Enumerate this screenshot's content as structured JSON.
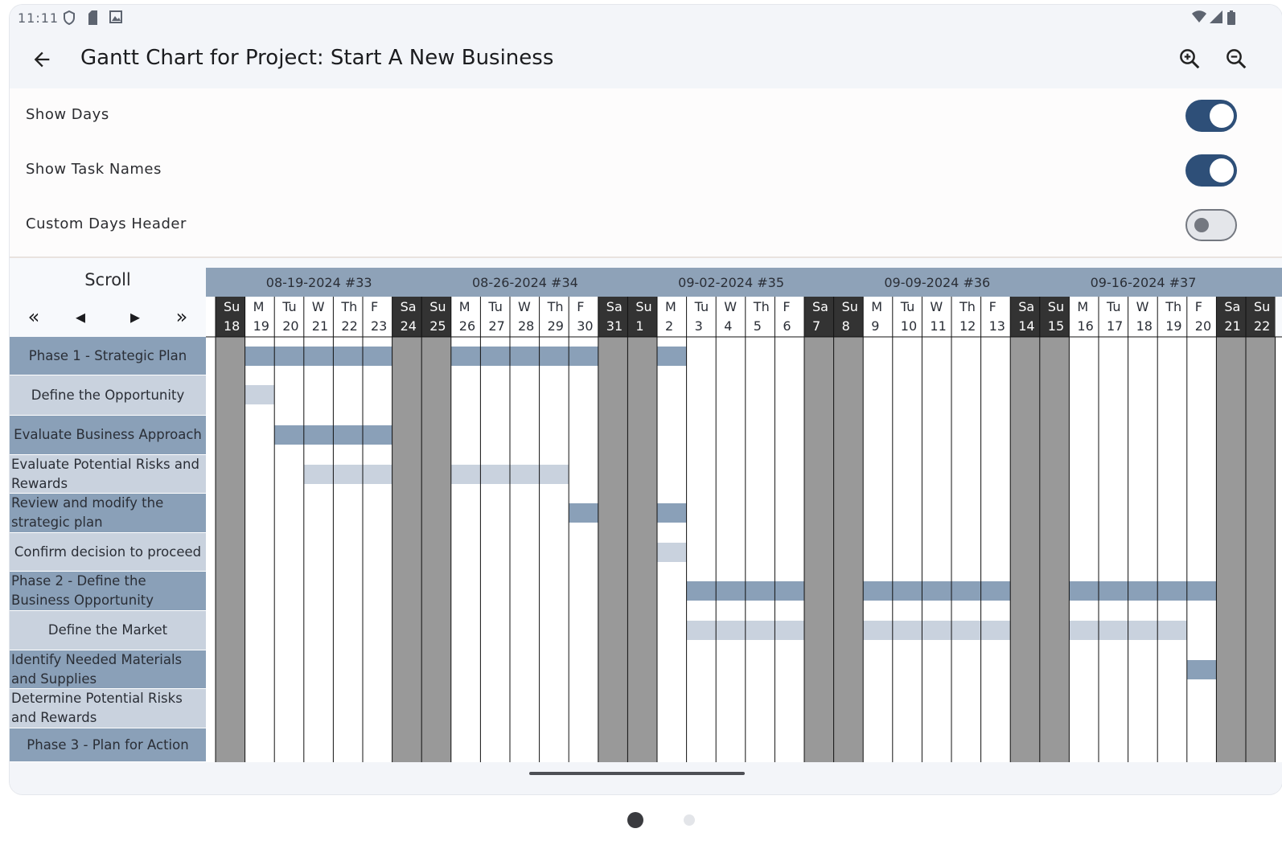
{
  "status_bar": {
    "time": "11:11"
  },
  "header": {
    "title": "Gantt Chart for Project:  Start A New Business"
  },
  "settings": [
    {
      "label": "Show Days",
      "on": true
    },
    {
      "label": "Show Task Names",
      "on": true
    },
    {
      "label": "Custom Days Header",
      "on": false
    }
  ],
  "scroll": {
    "title": "Scroll",
    "first": "«",
    "prev": "◂",
    "next": "▸",
    "last": "»"
  },
  "tasks": [
    {
      "name": "Phase 1 - Strategic Plan",
      "type": "phase"
    },
    {
      "name": "Define the Opportunity",
      "type": "sub"
    },
    {
      "name": "Evaluate Business Approach",
      "type": "phase"
    },
    {
      "name": "Evaluate Potential Risks and Rewards",
      "type": "sub"
    },
    {
      "name": "Review and modify the strategic plan",
      "type": "phase"
    },
    {
      "name": "Confirm decision to proceed",
      "type": "sub"
    },
    {
      "name": "Phase 2 - Define the Business Opportunity",
      "type": "phase"
    },
    {
      "name": "Define the Market",
      "type": "sub"
    },
    {
      "name": "Identify Needed Materials and Supplies",
      "type": "phase"
    },
    {
      "name": "Determine Potential Risks and Rewards",
      "type": "sub"
    },
    {
      "name": "Phase 3 - Plan for Action",
      "type": "phase"
    }
  ],
  "weeks": [
    "08-19-2024 #33",
    "08-26-2024 #34",
    "09-02-2024 #35",
    "09-09-2024 #36",
    "09-16-2024 #37"
  ],
  "days": [
    {
      "d": "Su",
      "n": "18",
      "w": true
    },
    {
      "d": "M",
      "n": "19",
      "w": false
    },
    {
      "d": "Tu",
      "n": "20",
      "w": false
    },
    {
      "d": "W",
      "n": "21",
      "w": false
    },
    {
      "d": "Th",
      "n": "22",
      "w": false
    },
    {
      "d": "F",
      "n": "23",
      "w": false
    },
    {
      "d": "Sa",
      "n": "24",
      "w": true
    },
    {
      "d": "Su",
      "n": "25",
      "w": true
    },
    {
      "d": "M",
      "n": "26",
      "w": false
    },
    {
      "d": "Tu",
      "n": "27",
      "w": false
    },
    {
      "d": "W",
      "n": "28",
      "w": false
    },
    {
      "d": "Th",
      "n": "29",
      "w": false
    },
    {
      "d": "F",
      "n": "30",
      "w": false
    },
    {
      "d": "Sa",
      "n": "31",
      "w": true
    },
    {
      "d": "Su",
      "n": "1",
      "w": true
    },
    {
      "d": "M",
      "n": "2",
      "w": false
    },
    {
      "d": "Tu",
      "n": "3",
      "w": false
    },
    {
      "d": "W",
      "n": "4",
      "w": false
    },
    {
      "d": "Th",
      "n": "5",
      "w": false
    },
    {
      "d": "F",
      "n": "6",
      "w": false
    },
    {
      "d": "Sa",
      "n": "7",
      "w": true
    },
    {
      "d": "Su",
      "n": "8",
      "w": true
    },
    {
      "d": "M",
      "n": "9",
      "w": false
    },
    {
      "d": "Tu",
      "n": "10",
      "w": false
    },
    {
      "d": "W",
      "n": "11",
      "w": false
    },
    {
      "d": "Th",
      "n": "12",
      "w": false
    },
    {
      "d": "F",
      "n": "13",
      "w": false
    },
    {
      "d": "Sa",
      "n": "14",
      "w": true
    },
    {
      "d": "Su",
      "n": "15",
      "w": true
    },
    {
      "d": "M",
      "n": "16",
      "w": false
    },
    {
      "d": "Tu",
      "n": "17",
      "w": false
    },
    {
      "d": "W",
      "n": "18",
      "w": false
    },
    {
      "d": "Th",
      "n": "19",
      "w": false
    },
    {
      "d": "F",
      "n": "20",
      "w": false
    },
    {
      "d": "Sa",
      "n": "21",
      "w": true
    },
    {
      "d": "Su",
      "n": "22",
      "w": true
    }
  ],
  "bars": [
    {
      "task": 0,
      "days": [
        1,
        2,
        3,
        4,
        5,
        8,
        9,
        10,
        11,
        12,
        15
      ]
    },
    {
      "task": 1,
      "days": [
        1
      ]
    },
    {
      "task": 2,
      "days": [
        2,
        3,
        4,
        5
      ]
    },
    {
      "task": 3,
      "days": [
        3,
        4,
        5,
        8,
        9,
        10,
        11
      ]
    },
    {
      "task": 4,
      "days": [
        12,
        15
      ]
    },
    {
      "task": 5,
      "days": [
        15
      ]
    },
    {
      "task": 6,
      "days": [
        16,
        17,
        18,
        19,
        22,
        23,
        24,
        25,
        26,
        29,
        30,
        31,
        32,
        33
      ]
    },
    {
      "task": 7,
      "days": [
        16,
        17,
        18,
        19,
        22,
        23,
        24,
        25,
        26,
        29,
        30,
        31,
        32
      ]
    },
    {
      "task": 8,
      "days": [
        33
      ]
    }
  ],
  "colors": {
    "phase": "#8aa0b8",
    "sub": "#c9d2de",
    "weekend": "#999999",
    "header_dark": "#333333",
    "week_header": "#8ea2b8",
    "accent": "#2e4f78"
  },
  "icons": [
    "arrow-back-icon",
    "zoom-in-icon",
    "zoom-out-icon",
    "wifi-icon",
    "signal-icon",
    "battery-icon"
  ]
}
